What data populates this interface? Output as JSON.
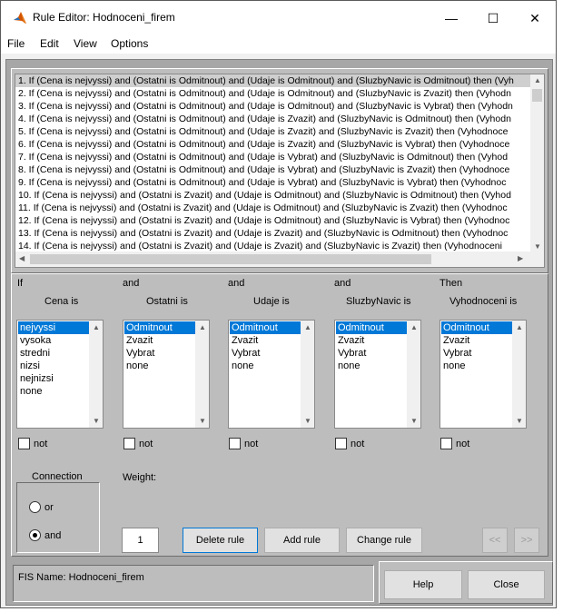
{
  "window": {
    "title": "Rule Editor: Hodnoceni_firem",
    "minimize_glyph": "—",
    "maximize_glyph": "☐",
    "close_glyph": "✕"
  },
  "menu": [
    "File",
    "Edit",
    "View",
    "Options"
  ],
  "rules": [
    "1. If (Cena is nejvyssi) and (Ostatni is Odmitnout) and (Udaje is Odmitnout) and (SluzbyNavic is Odmitnout) then (Vyh",
    "2. If (Cena is nejvyssi) and (Ostatni is Odmitnout) and (Udaje is Odmitnout) and (SluzbyNavic is Zvazit) then (Vyhodn",
    "3. If (Cena is nejvyssi) and (Ostatni is Odmitnout) and (Udaje is Odmitnout) and (SluzbyNavic is Vybrat) then (Vyhodn",
    "4. If (Cena is nejvyssi) and (Ostatni is Odmitnout) and (Udaje is Zvazit) and (SluzbyNavic is Odmitnout) then (Vyhodn",
    "5. If (Cena is nejvyssi) and (Ostatni is Odmitnout) and (Udaje is Zvazit) and (SluzbyNavic is Zvazit) then (Vyhodnoce",
    "6. If (Cena is nejvyssi) and (Ostatni is Odmitnout) and (Udaje is Zvazit) and (SluzbyNavic is Vybrat) then (Vyhodnoce",
    "7. If (Cena is nejvyssi) and (Ostatni is Odmitnout) and (Udaje is Vybrat) and (SluzbyNavic is Odmitnout) then (Vyhod",
    "8. If (Cena is nejvyssi) and (Ostatni is Odmitnout) and (Udaje is Vybrat) and (SluzbyNavic is Zvazit) then (Vyhodnoce",
    "9. If (Cena is nejvyssi) and (Ostatni is Odmitnout) and (Udaje is Vybrat) and (SluzbyNavic is Vybrat) then (Vyhodnoc",
    "10. If (Cena is nejvyssi) and (Ostatni is Zvazit) and (Udaje is Odmitnout) and (SluzbyNavic is Odmitnout) then (Vyhod",
    "11. If (Cena is nejvyssi) and (Ostatni is Zvazit) and (Udaje is Odmitnout) and (SluzbyNavic is Zvazit) then (Vyhodnoc",
    "12. If (Cena is nejvyssi) and (Ostatni is Zvazit) and (Udaje is Odmitnout) and (SluzbyNavic is Vybrat) then (Vyhodnoc",
    "13. If (Cena is nejvyssi) and (Ostatni is Zvazit) and (Udaje is Zvazit) and (SluzbyNavic is Odmitnout) then (Vyhodnoc",
    "14. If (Cena is nejvyssi) and (Ostatni is Zvazit) and (Udaje is Zvazit) and (SluzbyNavic is Zvazit) then (Vyhodnoceni"
  ],
  "columns": [
    {
      "connector": "If",
      "name": "Cena is",
      "items": [
        "nejvyssi",
        "vysoka",
        "stredni",
        "nizsi",
        "nejnizsi",
        "none"
      ],
      "selected": 0,
      "not_label": "not"
    },
    {
      "connector": "and",
      "name": "Ostatni is",
      "items": [
        "Odmitnout",
        "Zvazit",
        "Vybrat",
        "none"
      ],
      "selected": 0,
      "not_label": "not"
    },
    {
      "connector": "and",
      "name": "Udaje is",
      "items": [
        "Odmitnout",
        "Zvazit",
        "Vybrat",
        "none"
      ],
      "selected": 0,
      "not_label": "not"
    },
    {
      "connector": "and",
      "name": "SluzbyNavic is",
      "items": [
        "Odmitnout",
        "Zvazit",
        "Vybrat",
        "none"
      ],
      "selected": 0,
      "not_label": "not"
    },
    {
      "connector": "Then",
      "name": "Vyhodnoceni is",
      "items": [
        "Odmitnout",
        "Zvazit",
        "Vybrat",
        "none"
      ],
      "selected": 0,
      "not_label": "not"
    }
  ],
  "connection": {
    "title": "Connection",
    "or_label": "or",
    "and_label": "and",
    "selected": "and"
  },
  "weight": {
    "label": "Weight:",
    "value": "1"
  },
  "buttons": {
    "delete": "Delete rule",
    "add": "Add rule",
    "change": "Change rule",
    "prev": "<<",
    "next": ">>",
    "help": "Help",
    "close": "Close"
  },
  "status": "FIS Name: Hodnoceni_firem",
  "colors": {
    "selection": "#0078d7",
    "panel": "#bdbdbd",
    "icon": "#d35400"
  }
}
